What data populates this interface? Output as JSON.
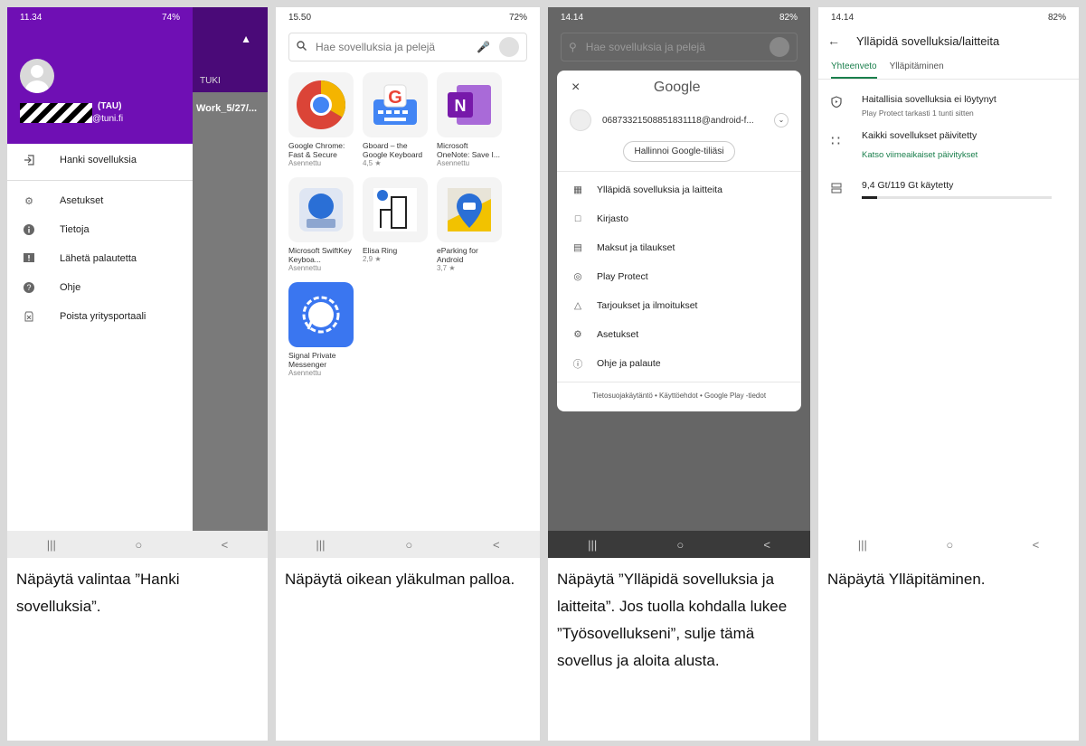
{
  "panel1": {
    "status": {
      "time": "11.34",
      "battery": "74%"
    },
    "user_label": "(TAU)",
    "email_suffix": "@tuni.fi",
    "right_tab": "TUKI",
    "right_item": "Work_5/27/...",
    "menu": [
      {
        "label": "Hanki sovelluksia",
        "icon": "login-icon"
      },
      {
        "label": "Asetukset",
        "icon": "gear-icon"
      },
      {
        "label": "Tietoja",
        "icon": "info-icon"
      },
      {
        "label": "Lähetä palautetta",
        "icon": "feedback-icon"
      },
      {
        "label": "Ohje",
        "icon": "help-icon"
      },
      {
        "label": "Poista yritysportaali",
        "icon": "delete-icon"
      }
    ],
    "caption": "Näpäytä valintaa ”Hanki sovelluksia”."
  },
  "panel2": {
    "status": {
      "time": "15.50",
      "battery": "72%"
    },
    "search_placeholder": "Hae sovelluksia ja pelejä",
    "apps": [
      {
        "name": "Google Chrome: Fast & Secure",
        "sub": "Asennettu",
        "icon": "chrome-icon"
      },
      {
        "name": "Gboard – the Google Keyboard",
        "sub": "4,5 ★",
        "icon": "gboard-icon"
      },
      {
        "name": "Microsoft OneNote: Save I...",
        "sub": "Asennettu",
        "icon": "onenote-icon"
      },
      {
        "name": "Microsoft SwiftKey Keyboa...",
        "sub": "Asennettu",
        "icon": "swiftkey-icon"
      },
      {
        "name": "Elisa Ring",
        "sub": "2,9 ★",
        "icon": "elisa-icon"
      },
      {
        "name": "eParking for Android",
        "sub": "3,7 ★",
        "icon": "eparking-icon"
      },
      {
        "name": "Signal Private Messenger",
        "sub": "Asennettu",
        "icon": "signal-icon"
      }
    ],
    "caption": "Näpäytä oikean yläkulman palloa."
  },
  "panel3": {
    "status": {
      "time": "14.14",
      "battery": "82%"
    },
    "search_placeholder": "Hae sovelluksia ja pelejä",
    "brand": "Google",
    "account": "06873321508851831118@android-f...",
    "manage_button": "Hallinnoi Google-tiliäsi",
    "menu": [
      {
        "label": "Ylläpidä sovelluksia ja laitteita",
        "icon": "grid-icon"
      },
      {
        "label": "Kirjasto",
        "icon": "folder-icon"
      },
      {
        "label": "Maksut ja tilaukset",
        "icon": "card-icon"
      },
      {
        "label": "Play Protect",
        "icon": "shield-icon"
      },
      {
        "label": "Tarjoukset ja ilmoitukset",
        "icon": "bell-icon"
      },
      {
        "label": "Asetukset",
        "icon": "gear-icon"
      },
      {
        "label": "Ohje ja palaute",
        "icon": "help-icon"
      }
    ],
    "footer": "Tietosuojakäytäntö • Käyttöehdot • Google Play -tiedot",
    "caption": "Näpäytä ”Ylläpidä sovelluksia ja laitteita”. Jos tuolla kohdalla lukee ”Työsovellukseni”, sulje tämä sovellus ja aloita alusta."
  },
  "panel4": {
    "status": {
      "time": "14.14",
      "battery": "82%"
    },
    "title": "Ylläpidä sovelluksia/laitteita",
    "tabs": [
      "Yhteenveto",
      "Ylläpitäminen"
    ],
    "items": [
      {
        "title": "Haitallisia sovelluksia ei löytynyt",
        "sub": "Play Protect tarkasti 1 tunti sitten",
        "icon": "shield-icon"
      },
      {
        "title": "Kaikki sovellukset päivitetty",
        "link": "Katso viimeaikaiset päivitykset",
        "icon": "update-icon"
      },
      {
        "title": "9,4 Gt/119 Gt käytetty",
        "icon": "storage-icon",
        "progress": 0.079
      }
    ],
    "caption": "Näpäytä Ylläpitäminen."
  },
  "nav": {
    "recent": "|||",
    "home": "○",
    "back": "<"
  }
}
